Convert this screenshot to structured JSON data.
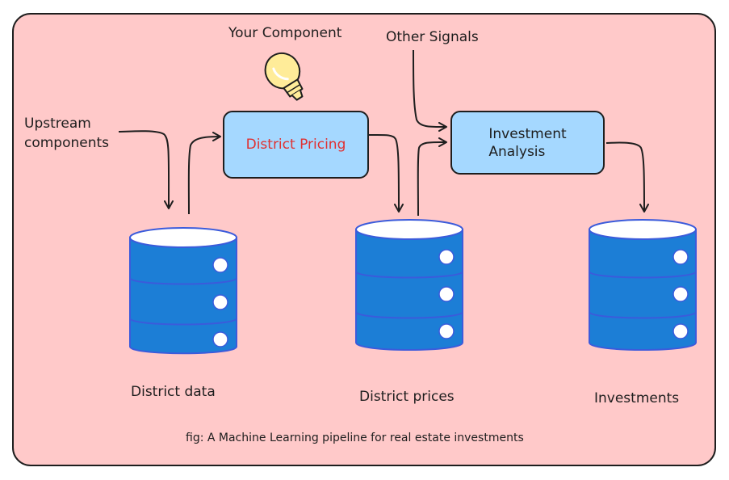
{
  "labels": {
    "your_component": "Your Component",
    "other_signals": "Other Signals",
    "upstream_line1": "Upstream",
    "upstream_line2": "components",
    "district_data": "District data",
    "district_prices": "District prices",
    "investments": "Investments",
    "caption": "fig: A Machine Learning pipeline for real estate investments"
  },
  "boxes": {
    "district_pricing": "District Pricing",
    "investment_analysis_line1": "Investment",
    "investment_analysis_line2": "Analysis"
  },
  "colors": {
    "frame_fill": "#ffc9c9",
    "stroke": "#1e1e1e",
    "box_fill": "#a5d8ff",
    "highlight_text": "#e03131",
    "db_fill": "#1c7ed6",
    "db_stroke": "#3b5bdb",
    "bulb_fill": "#ffec99"
  },
  "icons": [
    "lightbulb-icon",
    "database-icon"
  ]
}
